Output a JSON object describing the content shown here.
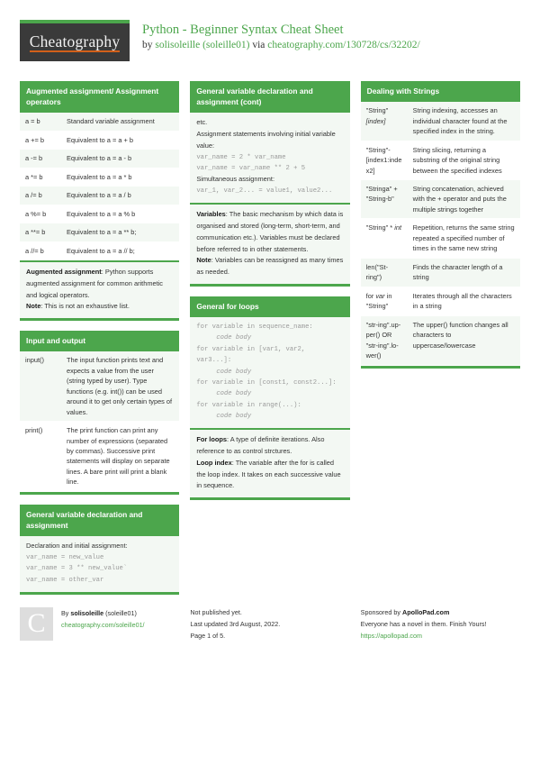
{
  "masthead": {
    "logo_text": "Cheatography",
    "title": "Python - Beginner Syntax Cheat Sheet",
    "by_prefix": "by ",
    "author": "solisoleille (soleille01)",
    "via": " via ",
    "source_url": "cheatography.com/130728/cs/32202/"
  },
  "cards": {
    "augmented": {
      "title": "Augmented assignment/ Assignment operators",
      "rows": [
        {
          "k": "a = b",
          "v": "Standard variable assignment"
        },
        {
          "k": "a += b",
          "v": "Equivalent to a = a + b"
        },
        {
          "k": "a -= b",
          "v": "Equivalent to a = a - b"
        },
        {
          "k": "a *= b",
          "v": "Equivalent to a = a * b"
        },
        {
          "k": "a /= b",
          "v": "Equivalent to a = a / b"
        },
        {
          "k": "a %= b",
          "v": "Equivalent to a = a % b"
        },
        {
          "k": "a **= b",
          "v": "Equivalent to a = a ** b;"
        },
        {
          "k": "a //= b",
          "v": "Equivalent to a = a // b;"
        }
      ],
      "note_label_1": "Augmented assignment",
      "note_text_1": ": Python supports augmented assignment for common arithmetic and logical operators.",
      "note_label_2": "Note",
      "note_text_2": ": This is not an exhaustive list."
    },
    "input_output": {
      "title": "Input and output",
      "rows": [
        {
          "k": "input()",
          "v": "The input function prints text and expects a value from the user (string typed by user). Type functions (e.g. int()) can be used around it to get only certain types of values."
        },
        {
          "k": "print()",
          "v": "The print function can print any number of expressions (separated by commas). Successive print statements will display on separate lines. A bare print will print a blank line."
        }
      ]
    },
    "var_decl": {
      "title": "General variable declaration and assignment",
      "line_1": "Declaration and initial assignment:",
      "code_1": "var_name = new_value",
      "code_2": "var_name = 3 ** new_value`",
      "code_3": "var_name = other_var"
    },
    "var_decl_cont": {
      "title": "General variable declaration and assignment (cont)",
      "line_1": "etc.",
      "line_2": "Assignment statements involving initial variable value:",
      "code_1": "var_name = 2 * var_name",
      "code_2": "var_name = var_name ** 2 + 5",
      "line_3": "Simultaneous assignment:",
      "code_3": "var_1, var_2... = value1, value2...",
      "note_label_1": "Variables",
      "note_text_1": ": The basic mechanism by which data is organised and stored (long-term, short-term, and communication etc.). Variables must be declared before referred to in other statements.",
      "note_label_2": "Note",
      "note_text_2": ": Variables can be reassigned as many times as needed."
    },
    "for_loops": {
      "title": "General for loops",
      "code_lines": [
        {
          "text": "for variable in sequence_name:",
          "indent": false
        },
        {
          "text": "code body",
          "indent": true
        },
        {
          "text": "for variable in [var1, var2, var3...]:",
          "indent": false
        },
        {
          "text": "code body",
          "indent": true
        },
        {
          "text": "for variable in [const1, const2...]:",
          "indent": false
        },
        {
          "text": "code body",
          "indent": true
        },
        {
          "text": "for variable in range(...):",
          "indent": false
        },
        {
          "text": "code body",
          "indent": true
        }
      ],
      "note_label_1": "For loops",
      "note_text_1": ": A type of definite iterations. Also reference to as control strctures.",
      "note_label_2": "Loop index",
      "note_text_2": ": The variable after the for is called the loop index. It takes on each successive value in sequence."
    },
    "strings": {
      "title": "Dealing with Strings",
      "rows": [
        {
          "k": "\"String\"[index]",
          "k_plain": "\"String\"",
          "k_italic": "[index]",
          "v": "String indexing, accesses an individual character found at the specified index in the string."
        },
        {
          "k": "\"String\"[index1:index2]",
          "k_plain": "\"String\"-[index1:index2]",
          "k_italic": "",
          "v": "String slicing, returning a substring of the original string between the specified indexes"
        },
        {
          "k": "\"Stringa\" + \"Stringb\"",
          "k_plain": "\"Stringa\" + \"String-b\"",
          "k_italic": "",
          "v": "String concatenation, achieved with the + operator and puts the multiple strings together"
        },
        {
          "k": "\"String\" * int",
          "k_plain": "\"String\" * ",
          "k_italic": "int",
          "v": "Repetition, returns the same string repeated a specified number of times in the same new string"
        },
        {
          "k": "len(\"String\")",
          "k_plain": "len(\"St-ring\")",
          "k_italic": "",
          "v": "Finds the character length of a string"
        },
        {
          "k": "for var in \"String\"",
          "k_plain": "for ",
          "k_italic": "var",
          "k_plain2": " in \"String\"",
          "v": "Iterates through all the characters in a string"
        },
        {
          "k": "\"string\".upper() OR \"string\".lower()",
          "k_plain": "\"str-ing\".up-per() OR \"str-ing\".lo-wer()",
          "k_italic": "",
          "v": "The upper() function changes all characters to uppercase/lowercase"
        }
      ]
    }
  },
  "footer": {
    "avatar_letter": "C",
    "by_label": "By ",
    "author_bold": "solisoleille",
    "author_handle": " (soleille01)",
    "author_url": "cheatography.com/soleille01/",
    "publish_status": "Not published yet.",
    "last_updated": "Last updated 3rd August, 2022.",
    "page_number": "Page 1 of 5.",
    "sponsor_prefix": "Sponsored by ",
    "sponsor_name": "ApolloPad.com",
    "sponsor_tagline": "Everyone has a novel in them. Finish Yours!",
    "sponsor_url": "https://apollopad.com"
  }
}
